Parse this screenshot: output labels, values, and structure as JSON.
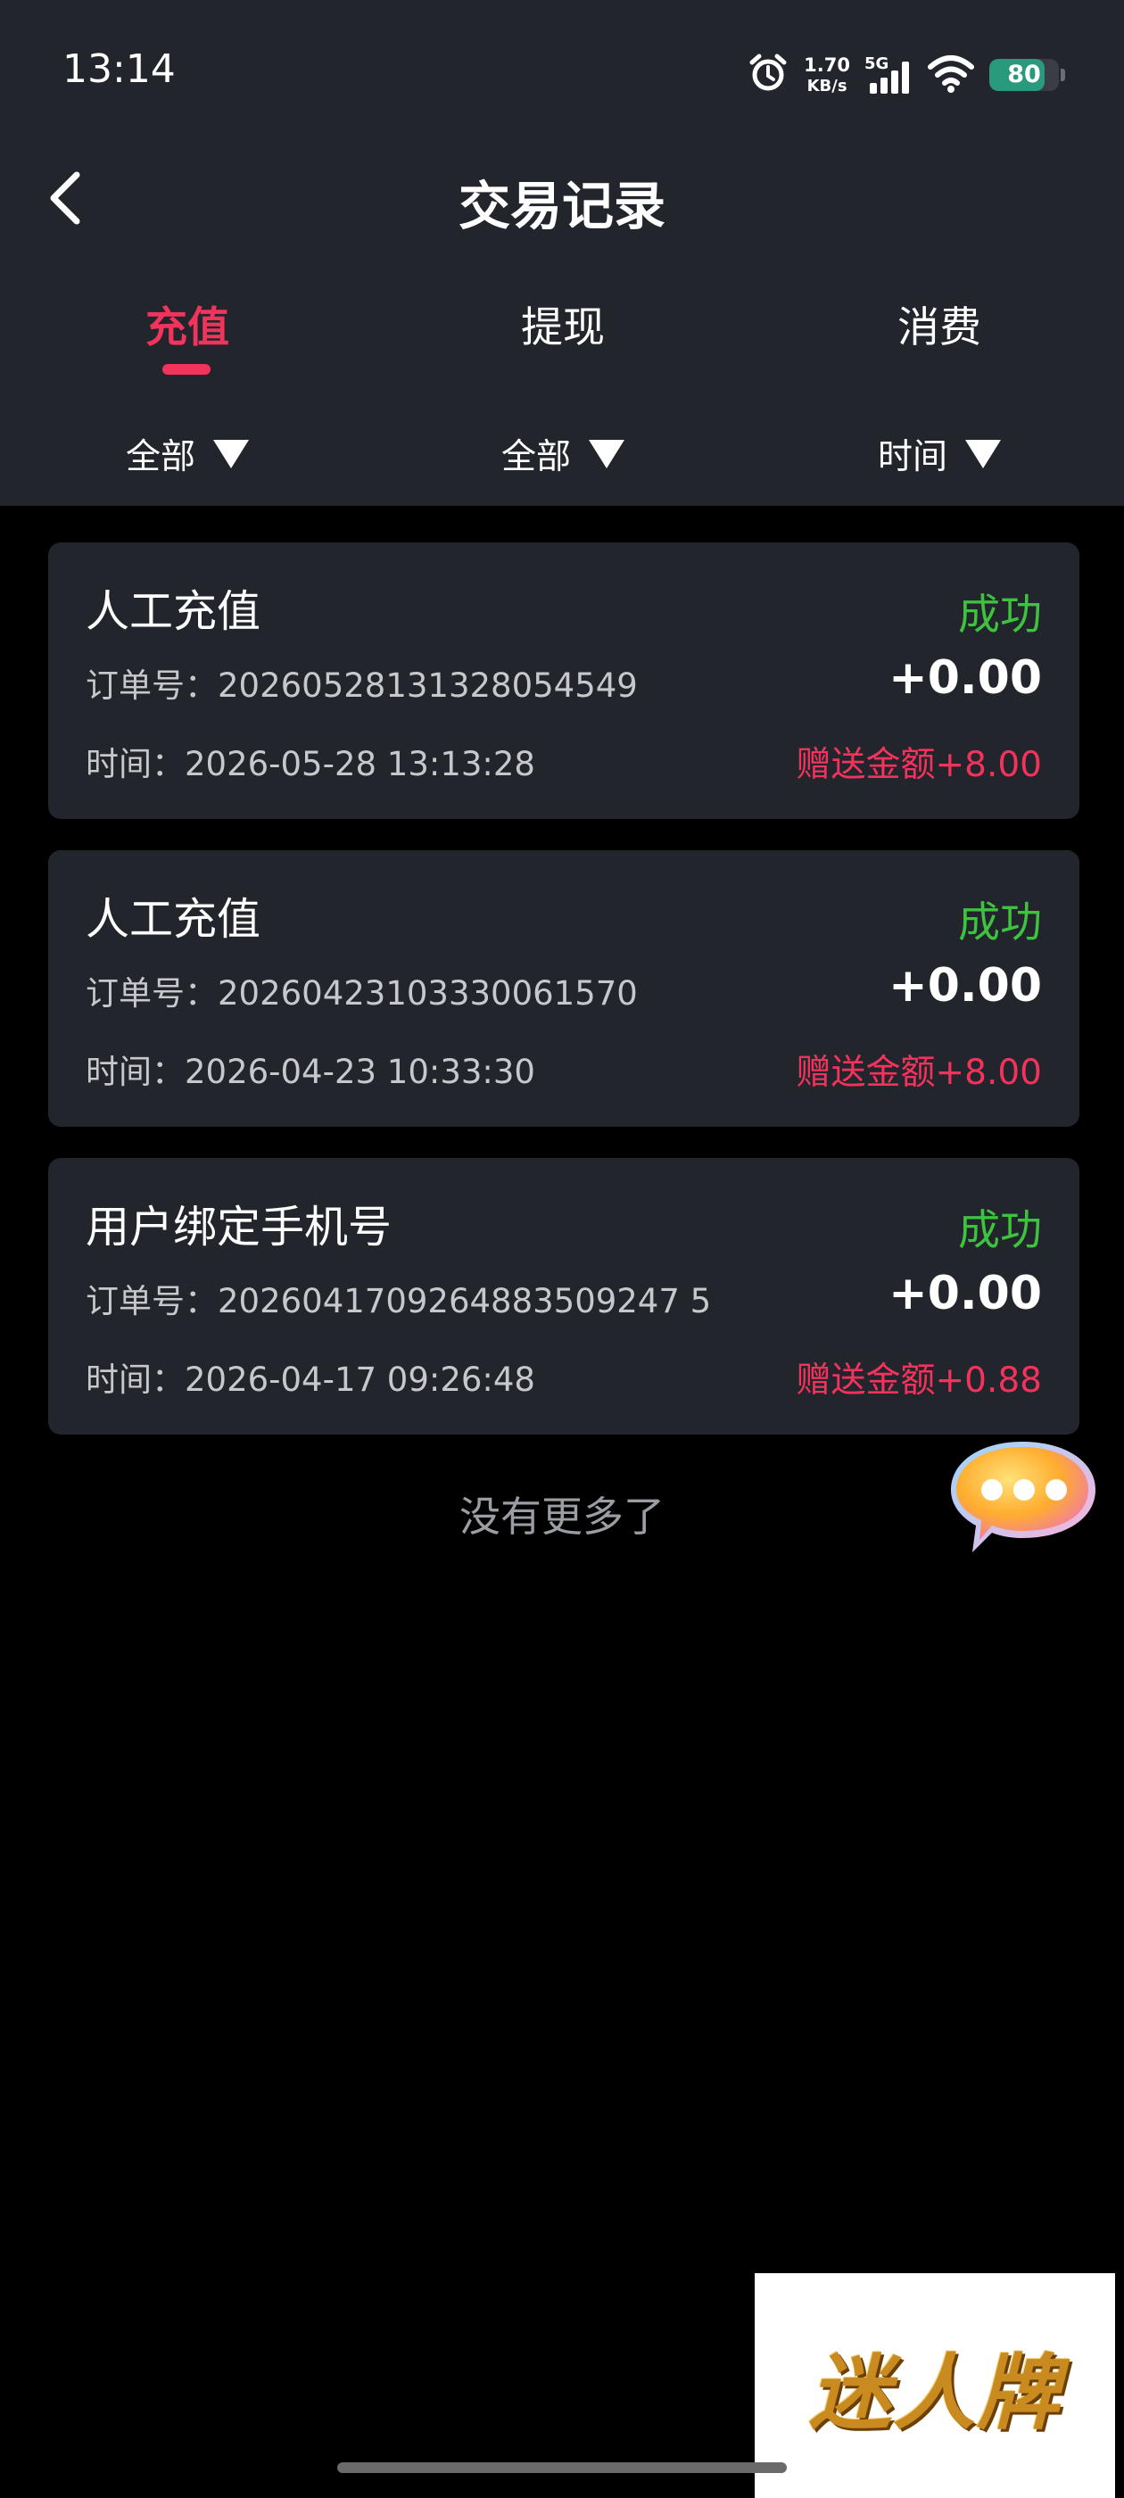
{
  "status_bar": {
    "time": "13:14",
    "net_speed_value": "1.70",
    "net_speed_unit": "KB/s",
    "network_type": "5G",
    "battery": "80",
    "battery_level": 0.8,
    "icons": [
      "alarm-icon",
      "cellular-signal-icon",
      "wifi-icon",
      "battery-icon"
    ]
  },
  "header": {
    "title": "交易记录"
  },
  "tabs": [
    {
      "label": "充值",
      "active": true
    },
    {
      "label": "提现",
      "active": false
    },
    {
      "label": "消费",
      "active": false
    }
  ],
  "filters": [
    {
      "label": "全部"
    },
    {
      "label": "全部"
    },
    {
      "label": "时间"
    }
  ],
  "records": [
    {
      "title": "人工充值",
      "status": "成功",
      "order_label": "订单号：",
      "order_no": "20260528131328054549",
      "amount": "+0.00",
      "time_label": "时间：",
      "time": "2026-05-28 13:13:28",
      "bonus": "赠送金额+8.00"
    },
    {
      "title": "人工充值",
      "status": "成功",
      "order_label": "订单号：",
      "order_no": "20260423103330061570",
      "amount": "+0.00",
      "time_label": "时间：",
      "time": "2026-04-23 10:33:30",
      "bonus": "赠送金额+8.00"
    },
    {
      "title": "用户绑定手机号",
      "status": "成功",
      "order_label": "订单号：",
      "order_no": "2026041709264883509247 5",
      "amount": "+0.00",
      "time_label": "时间：",
      "time": "2026-04-17 09:26:48",
      "bonus": "赠送金额+0.88"
    }
  ],
  "footer_text": "没有更多了",
  "watermark": "迷人牌",
  "colors": {
    "accent": "#f3335c",
    "success": "#3ec23f",
    "header_bg": "#22252c",
    "card_bg": "#22252c",
    "page_bg": "#000000"
  }
}
